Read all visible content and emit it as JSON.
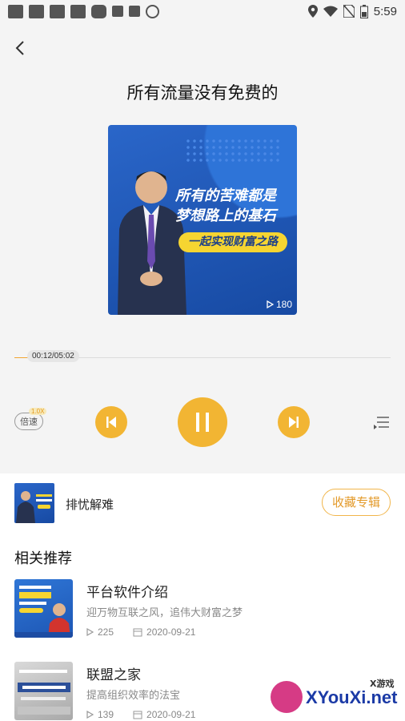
{
  "status_bar": {
    "time": "5:59"
  },
  "player": {
    "title": "所有流量没有免费的",
    "cover": {
      "slogan_line1": "所有的苦难都是",
      "slogan_line2": "梦想路上的基石",
      "pill_text": "一起实现财富之路",
      "play_count": "180"
    },
    "progress": {
      "current_total": "00:12/05:02",
      "fraction": 0.04
    },
    "speed_label": "倍速",
    "speed_badge": "1.0X",
    "accent_color": "#f2b533"
  },
  "album": {
    "name": "排忧解难",
    "favorite_label": "收藏专辑"
  },
  "recommend": {
    "section_title": "相关推荐",
    "items": [
      {
        "title": "平台软件介绍",
        "desc": "迎万物互联之风，追伟大财富之梦",
        "plays": "225",
        "date": "2020-09-21"
      },
      {
        "title": "联盟之家",
        "desc": "提高组织效率的法宝",
        "plays": "139",
        "date": "2020-09-21"
      }
    ]
  },
  "watermark": {
    "small": "X游戏",
    "big": "XYouXi.net"
  }
}
